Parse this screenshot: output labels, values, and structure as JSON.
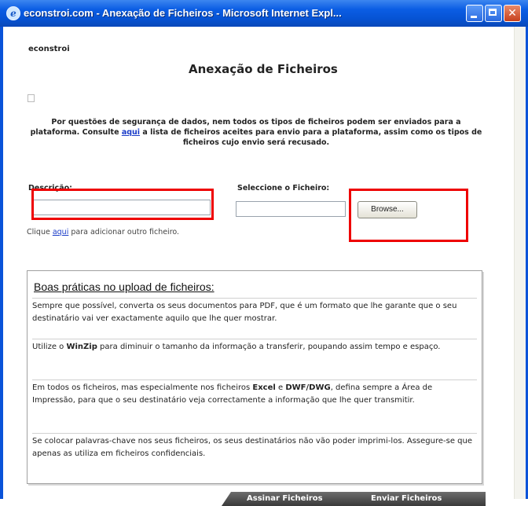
{
  "window": {
    "title": "econstroi.com - Anexação de Ficheiros - Microsoft Internet Expl...",
    "title_bar_color": "#0b5de4"
  },
  "page": {
    "brand": "econstroi",
    "title": "Anexação de Ficheiros",
    "intro_part1": "Por questões de segurança de dados, nem todos os tipos de ficheiros podem ser enviados para a plataforma. Consulte ",
    "intro_link": "aqui",
    "intro_part2": " a lista de ficheiros aceites para envio para a plataforma, assim como os tipos de ficheiros cujo envio será recusado."
  },
  "form": {
    "description_label": "Descrição:",
    "description_value": "",
    "file_label": "Seleccione o Ficheiro:",
    "file_value": "",
    "browse_label": "Browse...",
    "hint_before": "Clique ",
    "hint_link": "aqui",
    "hint_after": " para adicionar outro ficheiro."
  },
  "tips": {
    "title": "Boas práticas no upload de ficheiros:",
    "p1": "Sempre que possível, converta os seus documentos para PDF, que é um formato que lhe garante que o seu destinatário vai ver exactamente aquilo que lhe quer mostrar.",
    "p2_before": "Utilize o ",
    "p2_bold": "WinZip",
    "p2_after": " para diminuir o tamanho da informação a transferir, poupando assim tempo e espaço.",
    "p3_before": "Em todos os ficheiros, mas especialmente nos ficheiros ",
    "p3_bold1": "Excel",
    "p3_mid": " e ",
    "p3_bold2": "DWF/DWG",
    "p3_after": ", defina sempre a Área de Impressão, para que o seu destinatário veja correctamente a informação que lhe quer transmitir.",
    "p4": "Se colocar palavras-chave nos seus ficheiros, os seus destinatários não vão poder imprimi-los. Assegure-se que apenas as utiliza em ficheiros confidenciais."
  },
  "actions": {
    "sign": "Assinar Ficheiros",
    "send": "Enviar Ficheiros"
  },
  "colors": {
    "highlight": "#ee0000",
    "link": "#1a3cc8"
  }
}
